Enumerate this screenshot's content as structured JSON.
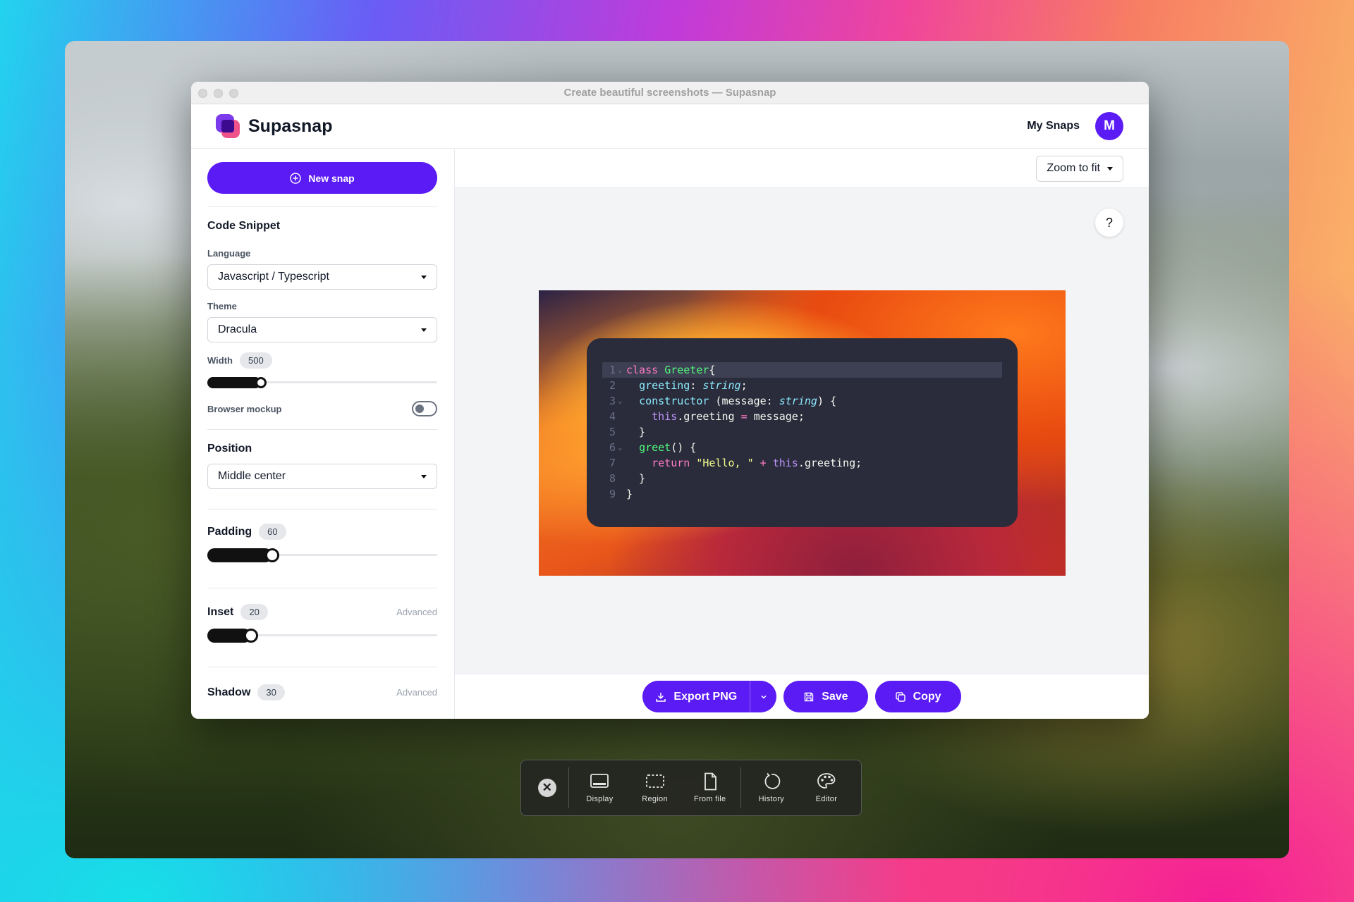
{
  "window": {
    "title": "Create beautiful screenshots — Supasnap"
  },
  "header": {
    "brand": "Supasnap",
    "my_snaps": "My Snaps",
    "avatar_initial": "M"
  },
  "sidebar": {
    "new_snap": "New snap",
    "code_snippet": {
      "title": "Code Snippet",
      "language_label": "Language",
      "language_value": "Javascript / Typescript",
      "theme_label": "Theme",
      "theme_value": "Dracula",
      "width_label": "Width",
      "width_value": "500",
      "width_fraction": 0.21,
      "browser_mockup_label": "Browser mockup",
      "browser_mockup_on": false
    },
    "position": {
      "title": "Position",
      "value": "Middle center"
    },
    "padding": {
      "title": "Padding",
      "value": "60",
      "fraction": 0.25
    },
    "inset": {
      "title": "Inset",
      "value": "20",
      "advanced": "Advanced",
      "fraction": 0.16
    },
    "shadow": {
      "title": "Shadow",
      "value": "30",
      "advanced": "Advanced"
    }
  },
  "main": {
    "zoom": "Zoom to fit",
    "help": "?"
  },
  "code": {
    "lines": [
      {
        "n": "1",
        "fold": true,
        "tokens": [
          [
            "kw",
            "class "
          ],
          [
            "cls",
            "Greeter"
          ],
          [
            "",
            "{"
          ]
        ]
      },
      {
        "n": "2",
        "fold": false,
        "tokens": [
          [
            "",
            "  "
          ],
          [
            "prop",
            "greeting"
          ],
          [
            "",
            ": "
          ],
          [
            "type",
            "string"
          ],
          [
            "",
            ";"
          ]
        ]
      },
      {
        "n": "3",
        "fold": true,
        "tokens": [
          [
            "",
            "  "
          ],
          [
            "prop",
            "constructor"
          ],
          [
            "",
            " (message: "
          ],
          [
            "type",
            "string"
          ],
          [
            "",
            ") {"
          ]
        ]
      },
      {
        "n": "4",
        "fold": false,
        "tokens": [
          [
            "",
            "    "
          ],
          [
            "this",
            "this"
          ],
          [
            "",
            ".greeting "
          ],
          [
            "kw",
            "="
          ],
          [
            "",
            " message;"
          ]
        ]
      },
      {
        "n": "5",
        "fold": false,
        "tokens": [
          [
            "",
            "  }"
          ]
        ]
      },
      {
        "n": "6",
        "fold": true,
        "tokens": [
          [
            "",
            "  "
          ],
          [
            "cls",
            "greet"
          ],
          [
            "",
            "() {"
          ]
        ]
      },
      {
        "n": "7",
        "fold": false,
        "tokens": [
          [
            "",
            "    "
          ],
          [
            "kw",
            "return "
          ],
          [
            "str",
            "\"Hello, \""
          ],
          [
            "",
            " "
          ],
          [
            "kw",
            "+"
          ],
          [
            "",
            " "
          ],
          [
            "this",
            "this"
          ],
          [
            "",
            ".greeting;"
          ]
        ]
      },
      {
        "n": "8",
        "fold": false,
        "tokens": [
          [
            "",
            "  }"
          ]
        ]
      },
      {
        "n": "9",
        "fold": false,
        "tokens": [
          [
            "",
            "}"
          ]
        ]
      }
    ]
  },
  "footer": {
    "export": "Export PNG",
    "save": "Save",
    "copy": "Copy"
  },
  "dock": {
    "items": [
      {
        "label": "Display",
        "icon": "display-icon"
      },
      {
        "label": "Region",
        "icon": "region-icon"
      },
      {
        "label": "From file",
        "icon": "file-icon"
      },
      {
        "label": "History",
        "icon": "history-icon"
      },
      {
        "label": "Editor",
        "icon": "palette-icon"
      }
    ]
  }
}
